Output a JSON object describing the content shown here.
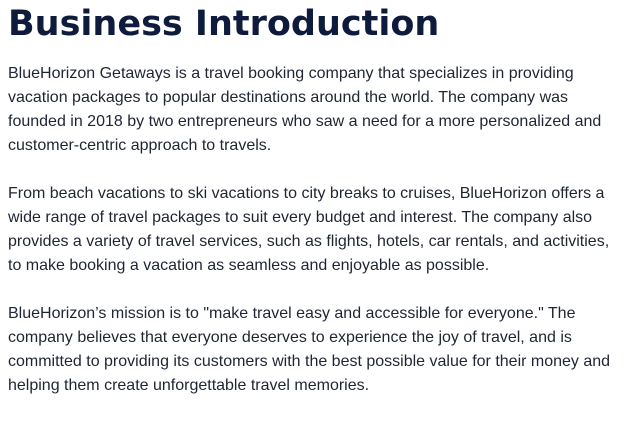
{
  "document": {
    "title": "Business Introduction",
    "paragraphs": [
      "BlueHorizon Getaways is a travel booking company that specializes in providing vacation packages to popular destinations around the world. The company was founded in 2018 by two entrepreneurs who saw a need for a more personalized and customer-centric approach to travels.",
      "From beach vacations to ski vacations to city breaks to cruises, BlueHorizon offers a wide range of travel packages to suit every budget and interest. The company also provides a variety of travel services, such as flights, hotels, car rentals, and activities, to make booking a vacation as seamless and enjoyable as possible.",
      "BlueHorizon’s mission is to \"make travel easy and accessible for everyone.\" The company believes that everyone deserves to experience the joy of travel, and is committed to providing its customers with the best possible value for their money and helping them create unforgettable travel memories."
    ]
  },
  "colors": {
    "title": "#0f1b3d",
    "body_text": "#1e2533",
    "background": "#ffffff"
  }
}
